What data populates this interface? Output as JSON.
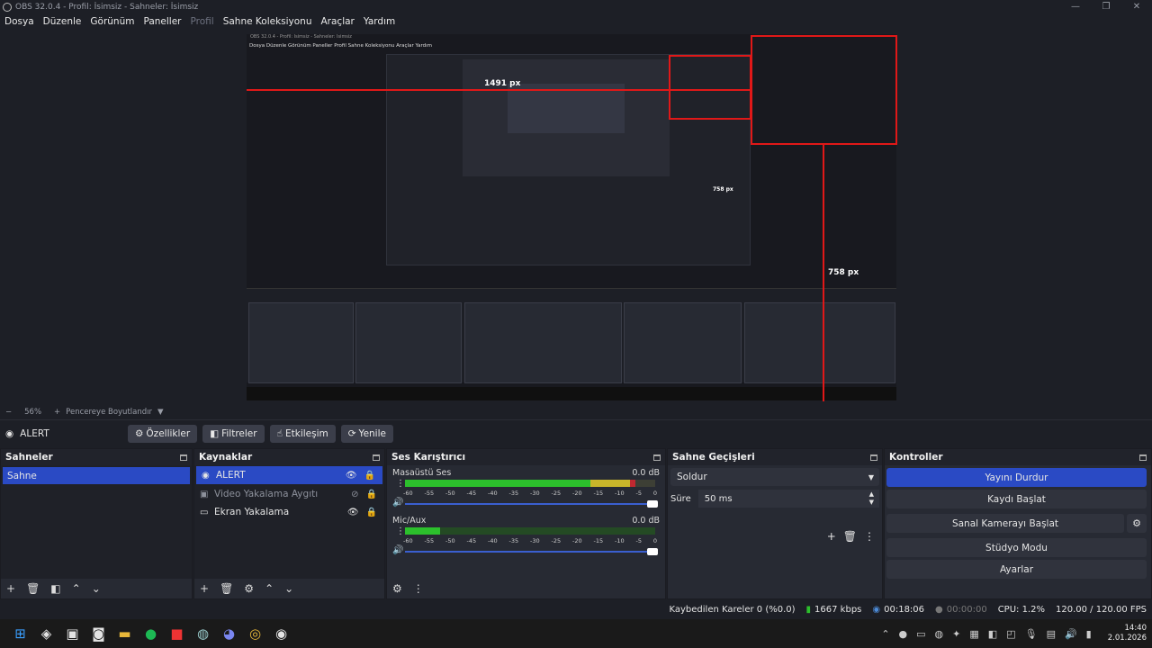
{
  "window": {
    "title": "OBS 32.0.4 - Profil: İsimsiz - Sahneler: İsimsiz",
    "controls": [
      "—",
      "❐",
      "✕"
    ]
  },
  "menu": {
    "items": [
      "Dosya",
      "Düzenle",
      "Görünüm",
      "Paneller",
      "Profil",
      "Sahne Koleksiyonu",
      "Araçlar",
      "Yardım"
    ]
  },
  "nested_preview": {
    "title": "OBS 32.0.4 - Profil: İsimsiz - Sahneler: İsimsiz",
    "menu": "Dosya  Düzenle  Görünüm  Paneller  Profil  Sahne Koleksiyonu  Araçlar  Yardım",
    "label_width": "1491 px",
    "label_height": "758 px",
    "label_height_small": "758 px"
  },
  "zoom": {
    "minus": "−",
    "level": "56%",
    "plus": "+",
    "fit_label": "Pencereye Boyutlandır",
    "arrow": "▼"
  },
  "source_toolbar": {
    "selected_source": "ALERT",
    "properties": "Özellikler",
    "filters": "Filtreler",
    "interact": "Etkileşim",
    "refresh": "Yenile"
  },
  "scenes": {
    "title": "Sahneler",
    "items": [
      "Sahne"
    ]
  },
  "sources": {
    "title": "Kaynaklar",
    "items": [
      {
        "name": "ALERT",
        "icon": "globe-icon"
      },
      {
        "name": "Video Yakalama Aygıtı",
        "icon": "camera-icon"
      },
      {
        "name": "Ekran Yakalama",
        "icon": "monitor-icon"
      }
    ]
  },
  "mixer": {
    "title": "Ses Karıştırıcı",
    "channels": [
      {
        "name": "Masaüstü Ses",
        "db": "0.0 dB",
        "level_pct": 92
      },
      {
        "name": "Mic/Aux",
        "db": "0.0 dB",
        "level_pct": 14
      }
    ],
    "ticks": [
      "-60",
      "-55",
      "-50",
      "-45",
      "-40",
      "-35",
      "-30",
      "-25",
      "-20",
      "-15",
      "-10",
      "-5",
      "0"
    ]
  },
  "transitions": {
    "title": "Sahne Geçişleri",
    "selected": "Soldur",
    "duration_label": "Süre",
    "duration_value": "50 ms"
  },
  "controls": {
    "title": "Kontroller",
    "stop_stream": "Yayını Durdur",
    "start_record": "Kaydı Başlat",
    "start_vcam": "Sanal Kamerayı Başlat",
    "studio_mode": "Stüdyo Modu",
    "settings": "Ayarlar"
  },
  "status": {
    "dropped": "Kaybedilen Kareler 0 (%0.0)",
    "bitrate": "1667 kbps",
    "stream_time": "00:18:06",
    "record_time": "00:00:00",
    "cpu": "CPU: 1.2%",
    "fps": "120.00 / 120.00 FPS"
  },
  "clock": {
    "time": "14:40",
    "date": "2.01.2026"
  },
  "colors": {
    "accent": "#2a4ac4",
    "meter_green": "#2cc02c",
    "meter_yellow": "#c8b52a",
    "meter_red": "#c02830",
    "overlay_red": "#e01818"
  }
}
